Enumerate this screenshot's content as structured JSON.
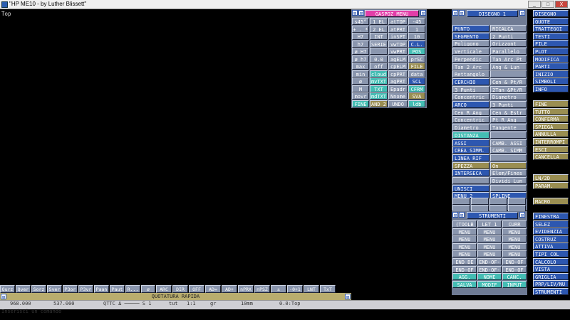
{
  "window": {
    "title": "\"HP ME10 - by Luther Blissett\"",
    "buttons": [
      "_",
      "□",
      "X"
    ]
  },
  "viewport": {
    "label": "Top"
  },
  "gaspoz": {
    "title": "GASPOZ MENU",
    "items": [
      [
        "s45°",
        "1 EL",
        "atTOP",
        "-45"
      ],
      [
        "+ . *",
        "2 EL",
        "atPRT",
        "1"
      ],
      [
        "H7",
        "INT",
        "inSPT",
        "10"
      ],
      [
        "h7",
        "SERIE",
        "vwTOP",
        "C.L."
      ],
      [
        "ø H7",
        "",
        "vwPRT",
        "POS"
      ],
      [
        "ø h7",
        "0.0",
        "agELM",
        "prSC"
      ],
      [
        "max",
        "off",
        "cpELM",
        "FILE"
      ],
      [
        "min",
        "cloud",
        "cpPRT",
        "data"
      ],
      [
        "ø",
        "mvTXT",
        "agPRT",
        "SCL"
      ],
      [
        "M",
        "TXT",
        "Epadr",
        "CFRM"
      ],
      [
        "movr",
        "mdTXT",
        "Nnome",
        "SVA"
      ],
      [
        "FINE",
        "AND 2",
        "UNDO",
        "ldb"
      ]
    ]
  },
  "disegno": {
    "title": "DISEGNO 1",
    "items": [
      [
        "PUNTO",
        "RICALCA"
      ],
      [
        "SEGMENTO",
        "2 Punti"
      ],
      [
        "Poligono",
        "Orizzont"
      ],
      [
        "Verticale",
        "Parallelo"
      ],
      [
        "Perpendic",
        "Tan Arc Pt"
      ],
      [
        "Tan 2 Arc",
        "Ang & Lun"
      ],
      [
        "Rettangolo",
        ""
      ],
      [
        "CERCHIO",
        "Cen & Pt/R"
      ],
      [
        "3 Punti",
        "2Tan &Pt/R"
      ],
      [
        "Concentric",
        "Diametro"
      ],
      [
        "ARCO",
        "3 Punti"
      ],
      [
        "Cen R Ang",
        "Cen & Estr"
      ],
      [
        "Concentric",
        "Pt R Ang"
      ],
      [
        "Diametro",
        "Tangente"
      ],
      [
        "DISTANZA",
        ""
      ],
      [
        "ASSI",
        "CAMB. ASSI"
      ],
      [
        "CREA SIMM.",
        "CAMB. SIMM"
      ],
      [
        "LINEA RIF",
        ""
      ],
      [
        "SPEZZA",
        "On"
      ],
      [
        "INTERSECA",
        "Elem/Fines"
      ],
      [
        "",
        "Dividi Lun"
      ],
      [
        "UNISCI",
        ""
      ],
      [
        "MENU 2",
        "SPLINE"
      ]
    ]
  },
  "strumenti": {
    "title": "STRUMENTI",
    "items": [
      [
        "(TOOLB",
        "LET 1",
        "CURR"
      ],
      [
        "MENU",
        "MENU",
        "MENU"
      ],
      [
        "MENU",
        "MENU",
        "MENU"
      ],
      [
        "MENU",
        "MENU",
        "MENU"
      ],
      [
        "MENU",
        "MENU",
        "MENU"
      ],
      [
        "END_DE",
        "END-OF-",
        "END-OF"
      ],
      [
        "END-OF",
        "END-OF-",
        "END-OF"
      ],
      [
        "AGG.",
        "NOME",
        "CANC."
      ],
      [
        "SALVA",
        "MODIF",
        "INPUT"
      ]
    ]
  },
  "rightmenu": {
    "top": [
      "DISEGNO",
      "QUOTE",
      "TRATTEGGI",
      "TESTI",
      "FILE",
      "PLOT",
      "MODIFICA",
      "PARTI",
      "INIZIO",
      "SIMBOLI",
      "INFO"
    ],
    "mid": [
      "FINE",
      "TUTTO",
      "CONFERMA",
      "SPIEGA",
      "ANNULLA",
      "INTERROMPI",
      "ESCI",
      "CANCELLA"
    ],
    "low": [
      "LN/2D",
      "PARAM.",
      "MACRO"
    ],
    "bottom": [
      "FINESTRA",
      "SELEZ",
      "EVIDENZIA",
      "COSTRUZ",
      "ATTIVA",
      "TIPI COL",
      "CALCOLO",
      "VISTA",
      "GRIGLIA",
      "PRP/LIV/NU",
      "STRUMENTI"
    ]
  },
  "toolbar": [
    "Qurz",
    "Qver",
    "Sorz",
    "Sver",
    "P3or",
    "P3vr",
    "Paan",
    "Paut",
    "R...",
    "ø",
    "ARC",
    "DIR",
    "OFF",
    "AD=",
    "AD+",
    "nPRX",
    "nPSZ",
    "±",
    "-0+1",
    "LNT",
    "TxT"
  ],
  "quotatura": "QUOTATURA RAPIDA",
  "status": {
    "x": "968.000",
    "y": "537.000",
    "qttc": "QTTC Δ ───── S 1",
    "tut": "tut",
    "scale": "1:1",
    "gr": "gr",
    "units": "10mm",
    "view": "0.0:Top"
  },
  "command": "Inserisci un comando"
}
